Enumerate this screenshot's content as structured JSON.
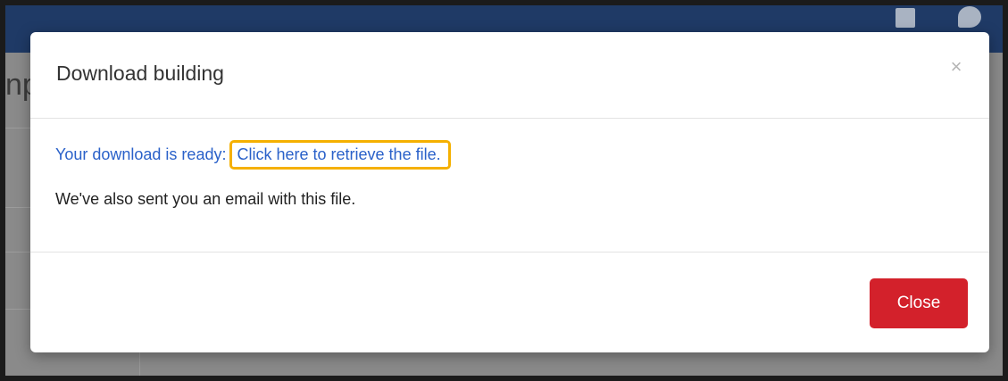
{
  "modal": {
    "title": "Download building",
    "close_symbol": "×",
    "ready_text": "Your download is ready",
    "separator": ":",
    "link_text": "Click here to retrieve the file.",
    "email_text": "We've also sent you an email with this file.",
    "close_button_label": "Close"
  },
  "background": {
    "partial_title": "np"
  },
  "colors": {
    "header_bar": "#1f3a66",
    "link": "#2a61c9",
    "highlight_outline": "#f5b000",
    "close_button": "#d3212b"
  },
  "icons": {
    "topbar_left": "notification-icon",
    "topbar_right": "chat-icon",
    "dialog_close": "close-icon"
  }
}
